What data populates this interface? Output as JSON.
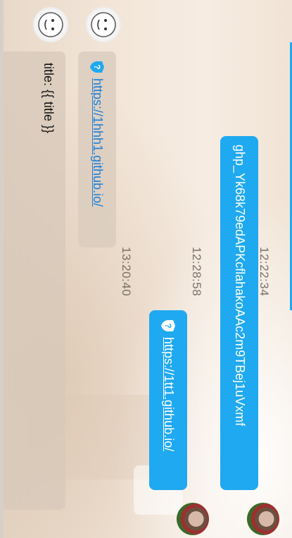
{
  "messages": [
    {
      "time": "12:22:34",
      "sender": "me",
      "text": "ghp_Yk68k79edAPKcflahakoAAc2m9TBej1uVxmf"
    },
    {
      "time": "12:28:58",
      "sender": "me",
      "link": "https://1tt1.github.io/"
    },
    {
      "time": "13:20:40",
      "sender": "other",
      "link": "https://1hhh1.github.io/"
    }
  ],
  "panel": {
    "line1": "title: {{ title }}"
  },
  "icons": {
    "help": "question-shield-icon",
    "sticker_avatar": "cartoon-face-avatar",
    "photo_avatar": "user-photo-avatar"
  },
  "colors": {
    "accent": "#1fa9f0",
    "panel": "#d7c8b9"
  }
}
